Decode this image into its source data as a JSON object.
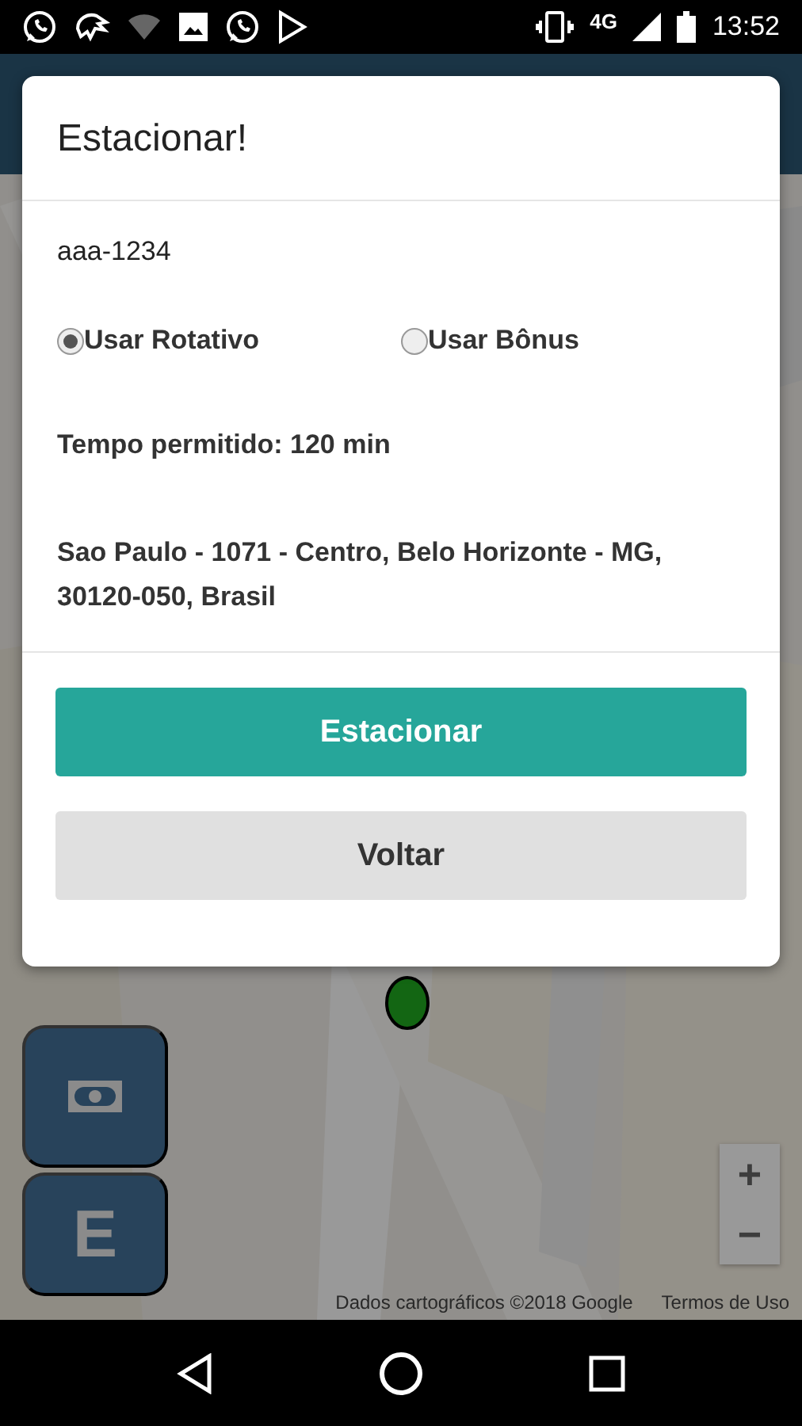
{
  "status_bar": {
    "network": "4G",
    "time": "13:52"
  },
  "dialog": {
    "title": "Estacionar!",
    "plate": "aaa-1234",
    "options": [
      {
        "label": "Usar Rotativo",
        "selected": true
      },
      {
        "label": "Usar Bônus",
        "selected": false
      }
    ],
    "allowed_time": "Tempo permitido: 120 min",
    "address": "Sao Paulo - 1071 - Centro, Belo Horizonte - MG, 30120-050, Brasil",
    "buttons": [
      {
        "label": "Estacionar",
        "kind": "primary"
      },
      {
        "label": "Voltar",
        "kind": "secondary"
      }
    ]
  },
  "map": {
    "side_buttons": [
      {
        "kind": "money"
      },
      {
        "kind": "letter",
        "label": "E"
      }
    ],
    "zoom": [
      "+",
      "−"
    ],
    "attribution": "Dados cartográficos ©2018 Google",
    "terms": "Termos de Uso"
  }
}
